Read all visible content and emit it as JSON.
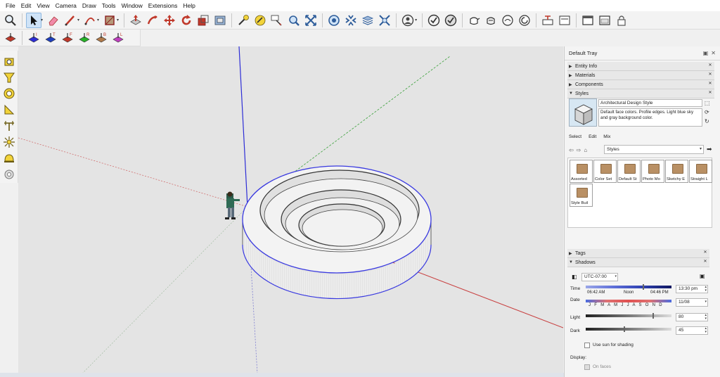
{
  "menu": [
    "File",
    "Edit",
    "View",
    "Camera",
    "Draw",
    "Tools",
    "Window",
    "Extensions",
    "Help"
  ],
  "toolbar_icons": [
    "zoom-icon",
    "select-icon",
    "eraser-icon",
    "line-icon",
    "arc-icon",
    "paint-bucket-icon",
    "push-pull-icon",
    "follow-me-icon",
    "move-icon",
    "rotate-icon",
    "scale-icon",
    "offset-icon",
    "tape-measure-icon",
    "protractor-icon",
    "text-icon",
    "orbit-icon",
    "pan-icon",
    "zoom-extents-icon",
    "previous-view-icon",
    "section-plane-icon",
    "warehouse-icon",
    "extension-icon",
    "hidden-line-icon",
    "shaded-icon",
    "xray-icon"
  ],
  "view_icons": [
    "iso-view-icon",
    "top-view-icon",
    "front-view-icon",
    "right-view-icon",
    "back-view-icon",
    "left-view-icon",
    "bottom-view-icon"
  ],
  "view_letters": [
    "I",
    "T",
    "F",
    "R",
    "B",
    "L"
  ],
  "tray": {
    "title": "Default Tray",
    "panels": {
      "entity_info": "Entity Info",
      "materials": "Materials",
      "components": "Components",
      "styles": "Styles",
      "tags": "Tags",
      "shadows": "Shadows"
    }
  },
  "styles": {
    "name": "Architectural Design Style",
    "description": "Default face colors. Profile edges. Light blue sky and gray background color.",
    "tabs": [
      "Select",
      "Edit",
      "Mix"
    ],
    "library": "Styles",
    "folders": [
      "Assorted",
      "Color Set",
      "Default St",
      "Photo Mo",
      "Sketchy E",
      "Straight L",
      "Style Buil"
    ]
  },
  "shadows": {
    "timezone": "UTC-07:00",
    "time_label": "Time",
    "time_start": "06:42 AM",
    "time_mid": "Noon",
    "time_end": "04:46 PM",
    "time_value": "13:30 pm",
    "date_label": "Date",
    "months": "J F M A M J J A S O N D",
    "date_value": "11/08",
    "light_label": "Light",
    "light_value": "80",
    "dark_label": "Dark",
    "dark_value": "45",
    "use_sun_label": "Use sun for shading",
    "display_label": "Display:",
    "on_faces_label": "On faces"
  },
  "colors": {
    "viewport_bg": "#e4e4e4",
    "blue_axis": "#2d2dd6",
    "red_axis": "#c84040",
    "green_axis": "#3aa03a",
    "edge_blue": "#3838e0"
  }
}
